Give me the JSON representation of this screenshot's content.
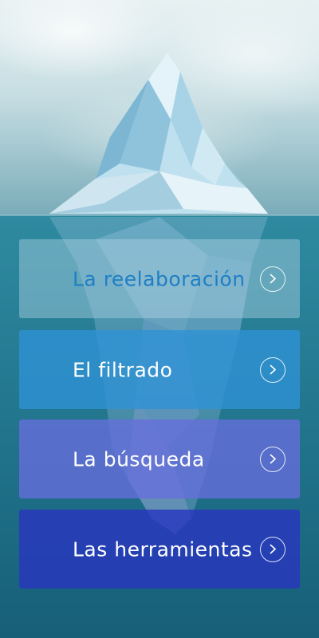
{
  "menu": {
    "items": [
      {
        "label": "La reelaboración",
        "icon": "chevron-right-icon",
        "color": "#b4d7e8"
      },
      {
        "label": "El filtrado",
        "icon": "chevron-right-icon",
        "color": "#2e92d6"
      },
      {
        "label": "La búsqueda",
        "icon": "chevron-right-icon",
        "color": "#676ed c"
      },
      {
        "label": "Las herramientas",
        "icon": "chevron-right-icon",
        "color": "#2837be"
      }
    ]
  },
  "background": {
    "image": "iceberg-illustration"
  }
}
